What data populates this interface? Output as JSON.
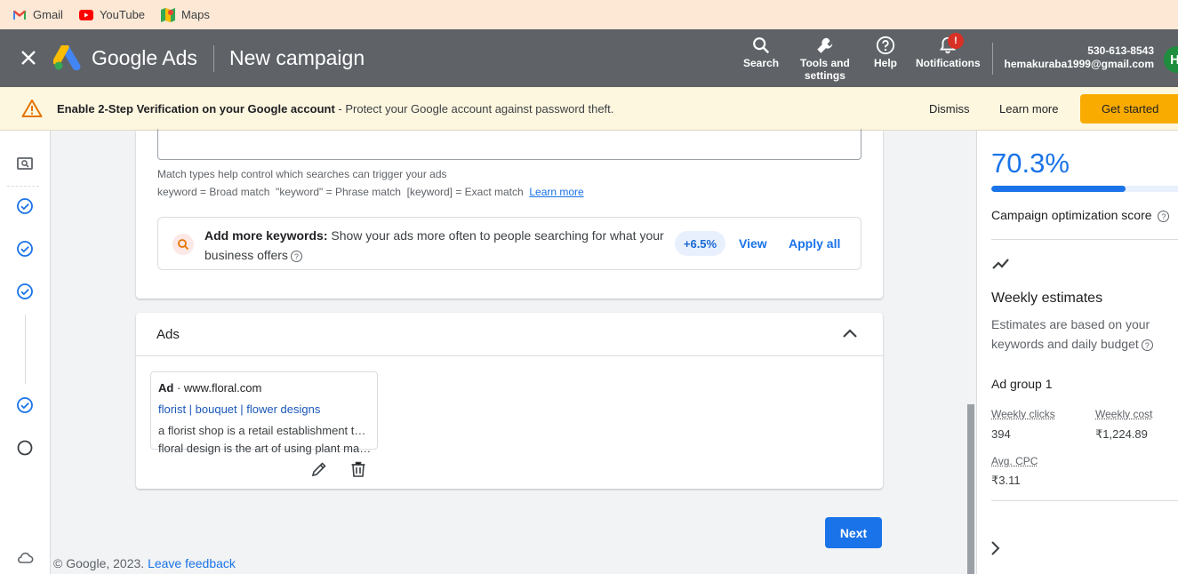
{
  "bookmarks": [
    {
      "label": "Gmail",
      "icon": "gmail-icon"
    },
    {
      "label": "YouTube",
      "icon": "youtube-icon"
    },
    {
      "label": "Maps",
      "icon": "maps-icon"
    }
  ],
  "header": {
    "product": "Google Ads",
    "page_title": "New campaign",
    "search_label": "Search",
    "tools_label_1": "Tools and",
    "tools_label_2": "settings",
    "help_label": "Help",
    "notifications_label": "Notifications",
    "notification_badge": "!",
    "phone": "530-613-8543",
    "email": "hemakuraba1999@gmail.com",
    "avatar_letter": "H"
  },
  "banner": {
    "bold": "Enable 2-Step Verification on your Google account",
    "rest": " - Protect your Google account against password theft.",
    "dismiss": "Dismiss",
    "learn_more": "Learn more",
    "get_started": "Get started"
  },
  "keywords": {
    "match_help": "Match types help control which searches can trigger your ads",
    "match_types": "keyword = Broad match  \"keyword\" = Phrase match  [keyword] = Exact match  ",
    "learn_more": "Learn more",
    "suggest_bold": "Add more keywords:",
    "suggest_text": " Show your ads more often to people searching for what your business offers",
    "uplift": "+6.5%",
    "view": "View",
    "apply_all": "Apply all"
  },
  "ads": {
    "title": "Ads",
    "ad_label": "Ad",
    "display_url": " · www.floral.com",
    "headline": "florist | bouquet | flower designs",
    "desc1": "a florist shop is a retail establishment that sells fresh flowers",
    "desc2": "floral design is the art of using plant materials and flowers"
  },
  "next_label": "Next",
  "footer": {
    "copyright": "© Google, 2023. ",
    "feedback": "Leave feedback"
  },
  "right_panel": {
    "score": "70.3%",
    "score_fraction": 0.703,
    "score_label": "Campaign optimization score",
    "weekly_title": "Weekly estimates",
    "weekly_desc": "Estimates are based on your keywords and daily budget",
    "ad_group": "Ad group 1",
    "clicks_label": "Weekly clicks",
    "clicks_value": "394",
    "cost_label": "Weekly cost",
    "cost_value": "₹1,224.89",
    "cpc_label": "Avg. CPC",
    "cpc_value": "₹3.11"
  },
  "colors": {
    "accent": "#1a73e8",
    "header_bg": "#5f6368",
    "banner_bg": "#fef7e0",
    "cta": "#f9ab00"
  }
}
